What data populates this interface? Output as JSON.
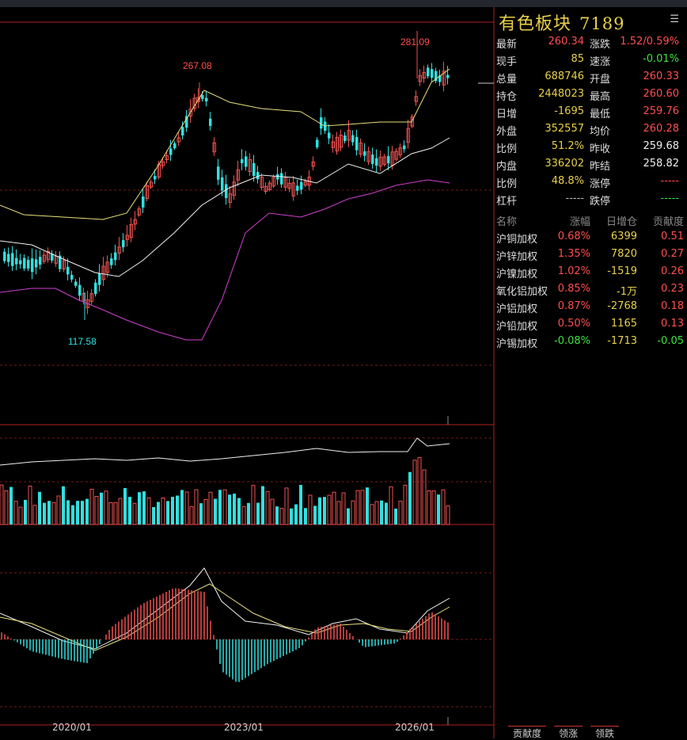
{
  "instrument": {
    "name": "有色板块",
    "code": "7189"
  },
  "quote": {
    "left": [
      {
        "label": "最新",
        "value": "260.34",
        "color": "red"
      },
      {
        "label": "现手",
        "value": "85",
        "color": "yellow"
      },
      {
        "label": "总量",
        "value": "688746",
        "color": "yellow"
      },
      {
        "label": "持仓",
        "value": "2448023",
        "color": "yellow"
      },
      {
        "label": "日增",
        "value": "-1695",
        "color": "yellow"
      },
      {
        "label": "外盘",
        "value": "352557",
        "color": "yellow"
      },
      {
        "label": "比例",
        "value": "51.2%",
        "color": "yellow"
      },
      {
        "label": "内盘",
        "value": "336202",
        "color": "yellow"
      },
      {
        "label": "比例",
        "value": "48.8%",
        "color": "yellow"
      },
      {
        "label": "杠杆",
        "value": "-----",
        "color": "gray"
      }
    ],
    "right": [
      {
        "label": "涨跌",
        "value": "1.52/0.59%",
        "color": "red"
      },
      {
        "label": "速涨",
        "value": "-0.01%",
        "color": "green"
      },
      {
        "label": "开盘",
        "value": "260.33",
        "color": "red"
      },
      {
        "label": "最高",
        "value": "260.60",
        "color": "red"
      },
      {
        "label": "最低",
        "value": "259.76",
        "color": "red"
      },
      {
        "label": "均价",
        "value": "260.28",
        "color": "red"
      },
      {
        "label": "昨收",
        "value": "259.68",
        "color": "white"
      },
      {
        "label": "昨结",
        "value": "258.82",
        "color": "white"
      },
      {
        "label": "涨停",
        "value": "-----",
        "color": "red"
      },
      {
        "label": "跌停",
        "value": "-----",
        "color": "green"
      }
    ]
  },
  "components": {
    "headers": [
      "名称",
      "涨幅",
      "日增仓",
      "贡献度"
    ],
    "rows": [
      {
        "name": "沪铜加权",
        "change": "0.68%",
        "oi": "6399",
        "contrib": "0.51",
        "dir": "red"
      },
      {
        "name": "沪锌加权",
        "change": "1.35%",
        "oi": "7820",
        "contrib": "0.27",
        "dir": "red"
      },
      {
        "name": "沪镍加权",
        "change": "1.02%",
        "oi": "-1519",
        "contrib": "0.26",
        "dir": "red"
      },
      {
        "name": "氧化铝加权",
        "change": "0.85%",
        "oi": "-1万",
        "contrib": "0.23",
        "dir": "red"
      },
      {
        "name": "沪铝加权",
        "change": "0.87%",
        "oi": "-2768",
        "contrib": "0.18",
        "dir": "red"
      },
      {
        "name": "沪铅加权",
        "change": "0.50%",
        "oi": "1165",
        "contrib": "0.13",
        "dir": "red"
      },
      {
        "name": "沪锡加权",
        "change": "-0.08%",
        "oi": "-1713",
        "contrib": "-0.05",
        "dir": "green"
      }
    ]
  },
  "tabs": [
    "贡献度",
    "领涨",
    "领跌"
  ],
  "chart": {
    "x_labels": [
      "2020/01",
      "2023/01",
      "2026/01"
    ],
    "annotations": {
      "high1": "267.08",
      "high2": "281.09",
      "low": "117.58"
    }
  },
  "colors": {
    "red": "#ff4e4e",
    "green": "#3ee03e",
    "yellow": "#e8d04a",
    "up": "#f05050",
    "down": "#30e0e0",
    "frame": "#b02020"
  }
}
